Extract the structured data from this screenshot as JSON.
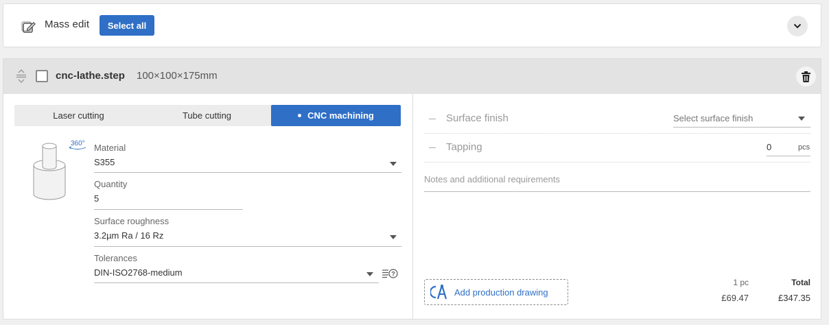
{
  "mass_edit": {
    "label": "Mass edit",
    "select_all_label": "Select all",
    "icon": "edit-icon",
    "collapse_icon": "chevron-down-icon"
  },
  "part": {
    "filename": "cnc-lathe.step",
    "dimensions": "100×100×175mm",
    "tabs": [
      {
        "label": "Laser cutting",
        "active": false
      },
      {
        "label": "Tube cutting",
        "active": false
      },
      {
        "label": "CNC machining",
        "active": true
      }
    ],
    "preview_badge": "360°",
    "material": {
      "label": "Material",
      "value": "S355"
    },
    "quantity": {
      "label": "Quantity",
      "value": "5"
    },
    "surface_roughness": {
      "label": "Surface roughness",
      "value": "3.2µm Ra / 16 Rz"
    },
    "tolerances": {
      "label": "Tolerances",
      "value": "DIN-ISO2768-medium"
    }
  },
  "options": {
    "surface_finish": {
      "label": "Surface finish",
      "placeholder": "Select surface finish"
    },
    "tapping": {
      "label": "Tapping",
      "value": "0",
      "unit": "pcs"
    },
    "notes_placeholder": "Notes and additional requirements"
  },
  "add_drawing_label": "Add production drawing",
  "pricing": {
    "unit_label": "1 pc",
    "unit_price": "£69.47",
    "total_label": "Total",
    "total_price": "£347.35"
  },
  "colors": {
    "accent": "#2f6fc6",
    "header_bg": "#e3e3e3",
    "page_bg": "#f0f0f0"
  }
}
